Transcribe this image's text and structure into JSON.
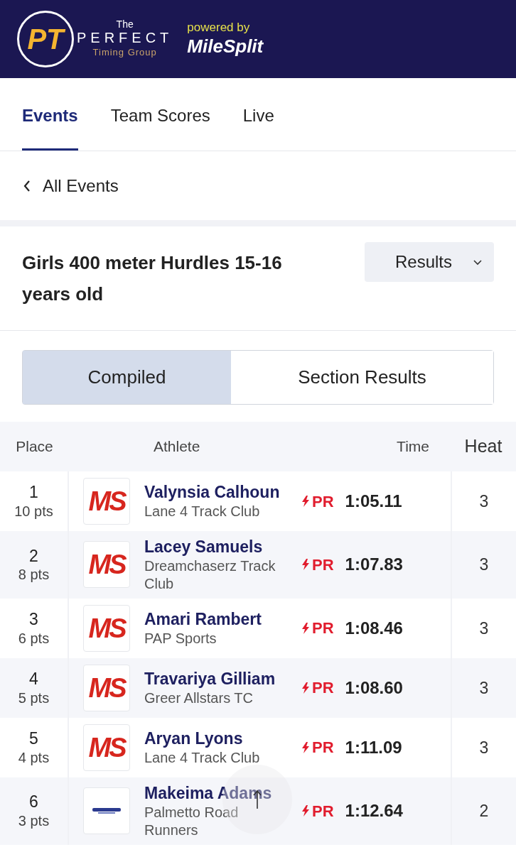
{
  "header": {
    "logo_letters": "PT",
    "logo_top": "The",
    "logo_name": "PERFECT",
    "logo_sub": "Timing Group",
    "powered_by": "powered by",
    "partner": "MileSplit"
  },
  "tabs": [
    {
      "label": "Events",
      "selected": true
    },
    {
      "label": "Team Scores",
      "selected": false
    },
    {
      "label": "Live",
      "selected": false
    }
  ],
  "back_link": "All Events",
  "event_title": "Girls 400 meter Hurdles 15-16 years old",
  "view_select": "Results",
  "segments": [
    {
      "label": "Compiled",
      "selected": true
    },
    {
      "label": "Section Results",
      "selected": false
    }
  ],
  "table": {
    "columns": [
      "Place",
      "Athlete",
      "Time",
      "Heat"
    ],
    "rows": [
      {
        "place": "1",
        "points": "10 pts",
        "logo": {
          "kind": "ms",
          "text": "MS"
        },
        "name": "Valynsia Calhoun",
        "team": "Lane 4 Track Club",
        "badge": "PR",
        "time": "1:05.11",
        "heat": "3"
      },
      {
        "place": "2",
        "points": "8 pts",
        "logo": {
          "kind": "ms",
          "text": "MS"
        },
        "name": "Lacey Samuels",
        "team": "Dreamchaserz Track Club",
        "badge": "PR",
        "time": "1:07.83",
        "heat": "3"
      },
      {
        "place": "3",
        "points": "6 pts",
        "logo": {
          "kind": "ms",
          "text": "MS"
        },
        "name": "Amari Rambert",
        "team": "PAP Sports",
        "badge": "PR",
        "time": "1:08.46",
        "heat": "3"
      },
      {
        "place": "4",
        "points": "5 pts",
        "logo": {
          "kind": "ms",
          "text": "MS"
        },
        "name": "Travariya Gilliam",
        "team": "Greer Allstars TC",
        "badge": "PR",
        "time": "1:08.60",
        "heat": "3"
      },
      {
        "place": "5",
        "points": "4 pts",
        "logo": {
          "kind": "ms",
          "text": "MS"
        },
        "name": "Aryan Lyons",
        "team": "Lane 4 Track Club",
        "badge": "PR",
        "time": "1:11.09",
        "heat": "3"
      },
      {
        "place": "6",
        "points": "3 pts",
        "logo": {
          "kind": "club"
        },
        "name": "Makeima Adams",
        "team": "Palmetto Road Runners",
        "badge": "PR",
        "time": "1:12.64",
        "heat": "2"
      }
    ]
  }
}
